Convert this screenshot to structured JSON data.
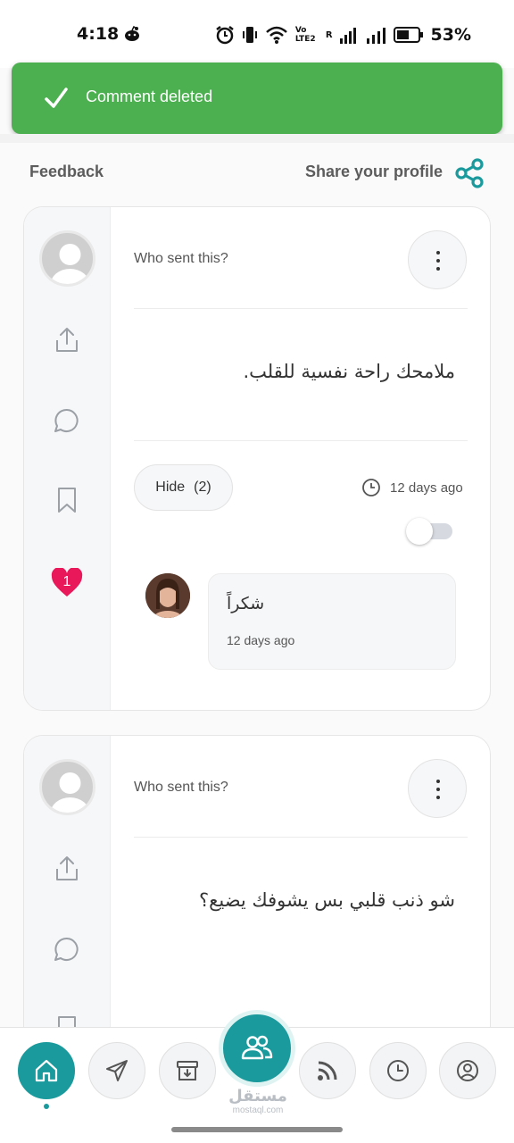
{
  "status_bar": {
    "time": "4:18",
    "battery": "53%",
    "network_label": "Vo LTE2",
    "roaming": "R"
  },
  "toast": {
    "message": "Comment deleted",
    "color": "#4caf50"
  },
  "header": {
    "feedback": "Feedback",
    "share_profile": "Share your profile"
  },
  "accent_color": "#1a9a9c",
  "posts": [
    {
      "sender": "Who sent this?",
      "message": "ملامحك راحة نفسية للقلب.",
      "hide_label": "Hide",
      "reply_count": "(2)",
      "time": "12 days ago",
      "likes": "1",
      "reply": {
        "text": "شكراً",
        "time": "12 days ago"
      }
    },
    {
      "sender": "Who sent this?",
      "message": "شو ذنب قلبي بس يشوفك يضيع؟"
    }
  ],
  "watermark": {
    "arabic": "مستقل",
    "latin": "mostaql.com"
  },
  "icons": [
    "share-icon",
    "upload-icon",
    "comment-icon",
    "bookmark-icon",
    "heart-icon",
    "clock-icon",
    "home-icon",
    "send-icon",
    "archive-icon",
    "people-icon",
    "rss-icon",
    "history-icon",
    "profile-icon"
  ]
}
